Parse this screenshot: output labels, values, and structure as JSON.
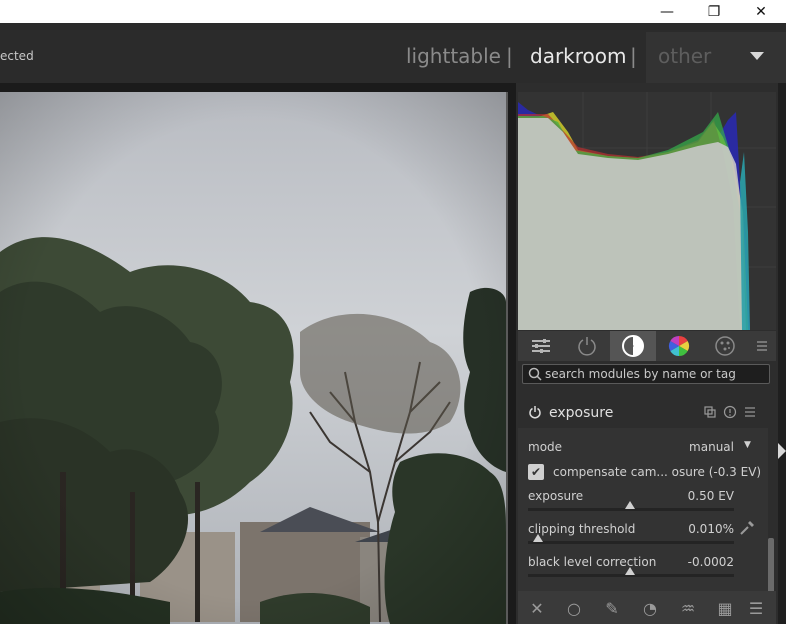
{
  "window": {
    "minimize_glyph": "—",
    "restore_glyph": "❐",
    "close_glyph": "✕"
  },
  "header": {
    "left_text": "ected",
    "views": {
      "lighttable": "lighttable",
      "separator": "|",
      "darkroom": "darkroom",
      "other": "other"
    }
  },
  "panel": {
    "tabs": [
      "quick-access-icon",
      "power-icon",
      "active-modules-icon",
      "color-wheel-icon",
      "effects-icon",
      "menu-icon"
    ],
    "search": {
      "placeholder": "search modules by name or tag"
    },
    "module": {
      "title": "exposure",
      "mode_label": "mode",
      "mode_value": "manual",
      "compensate_label": "compensate cam... osure (-0.3 EV)",
      "compensate_checked": true,
      "exposure_label": "exposure",
      "exposure_value": "0.50 EV",
      "clipping_label": "clipping threshold",
      "clipping_value": "0.010%",
      "black_label": "black level correction",
      "black_value": "-0.0002"
    },
    "bottom_icons": [
      "close-icon",
      "circle-icon",
      "pencil-icon",
      "path-icon",
      "brush-icon",
      "checkerboard-icon",
      "menu-icon"
    ]
  }
}
